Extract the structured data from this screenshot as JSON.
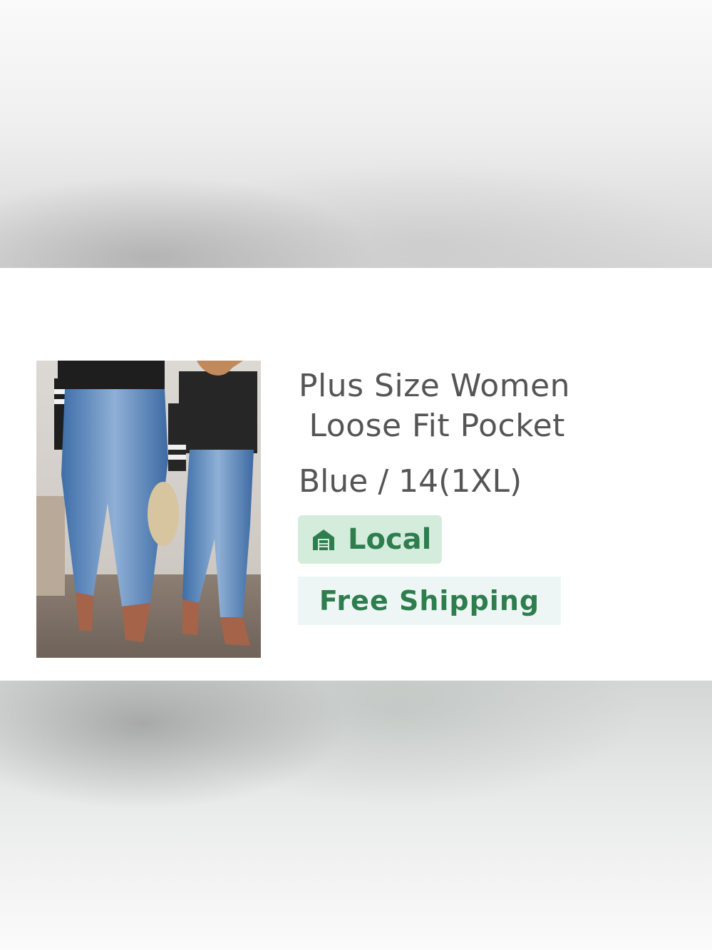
{
  "product": {
    "title_lines": [
      "Plus Size Women",
      " Loose Fit Pocket"
    ],
    "variant": "Blue / 14(1XL)",
    "image_icon": "product-photo-jeans"
  },
  "badges": {
    "local": {
      "label": "Local",
      "icon": "store-icon",
      "bg_color": "#d4ecdc",
      "text_color": "#2e7d4e"
    },
    "shipping": {
      "label": "Free Shipping",
      "bg_color": "#eef6f5",
      "text_color": "#2e7d4e"
    }
  }
}
